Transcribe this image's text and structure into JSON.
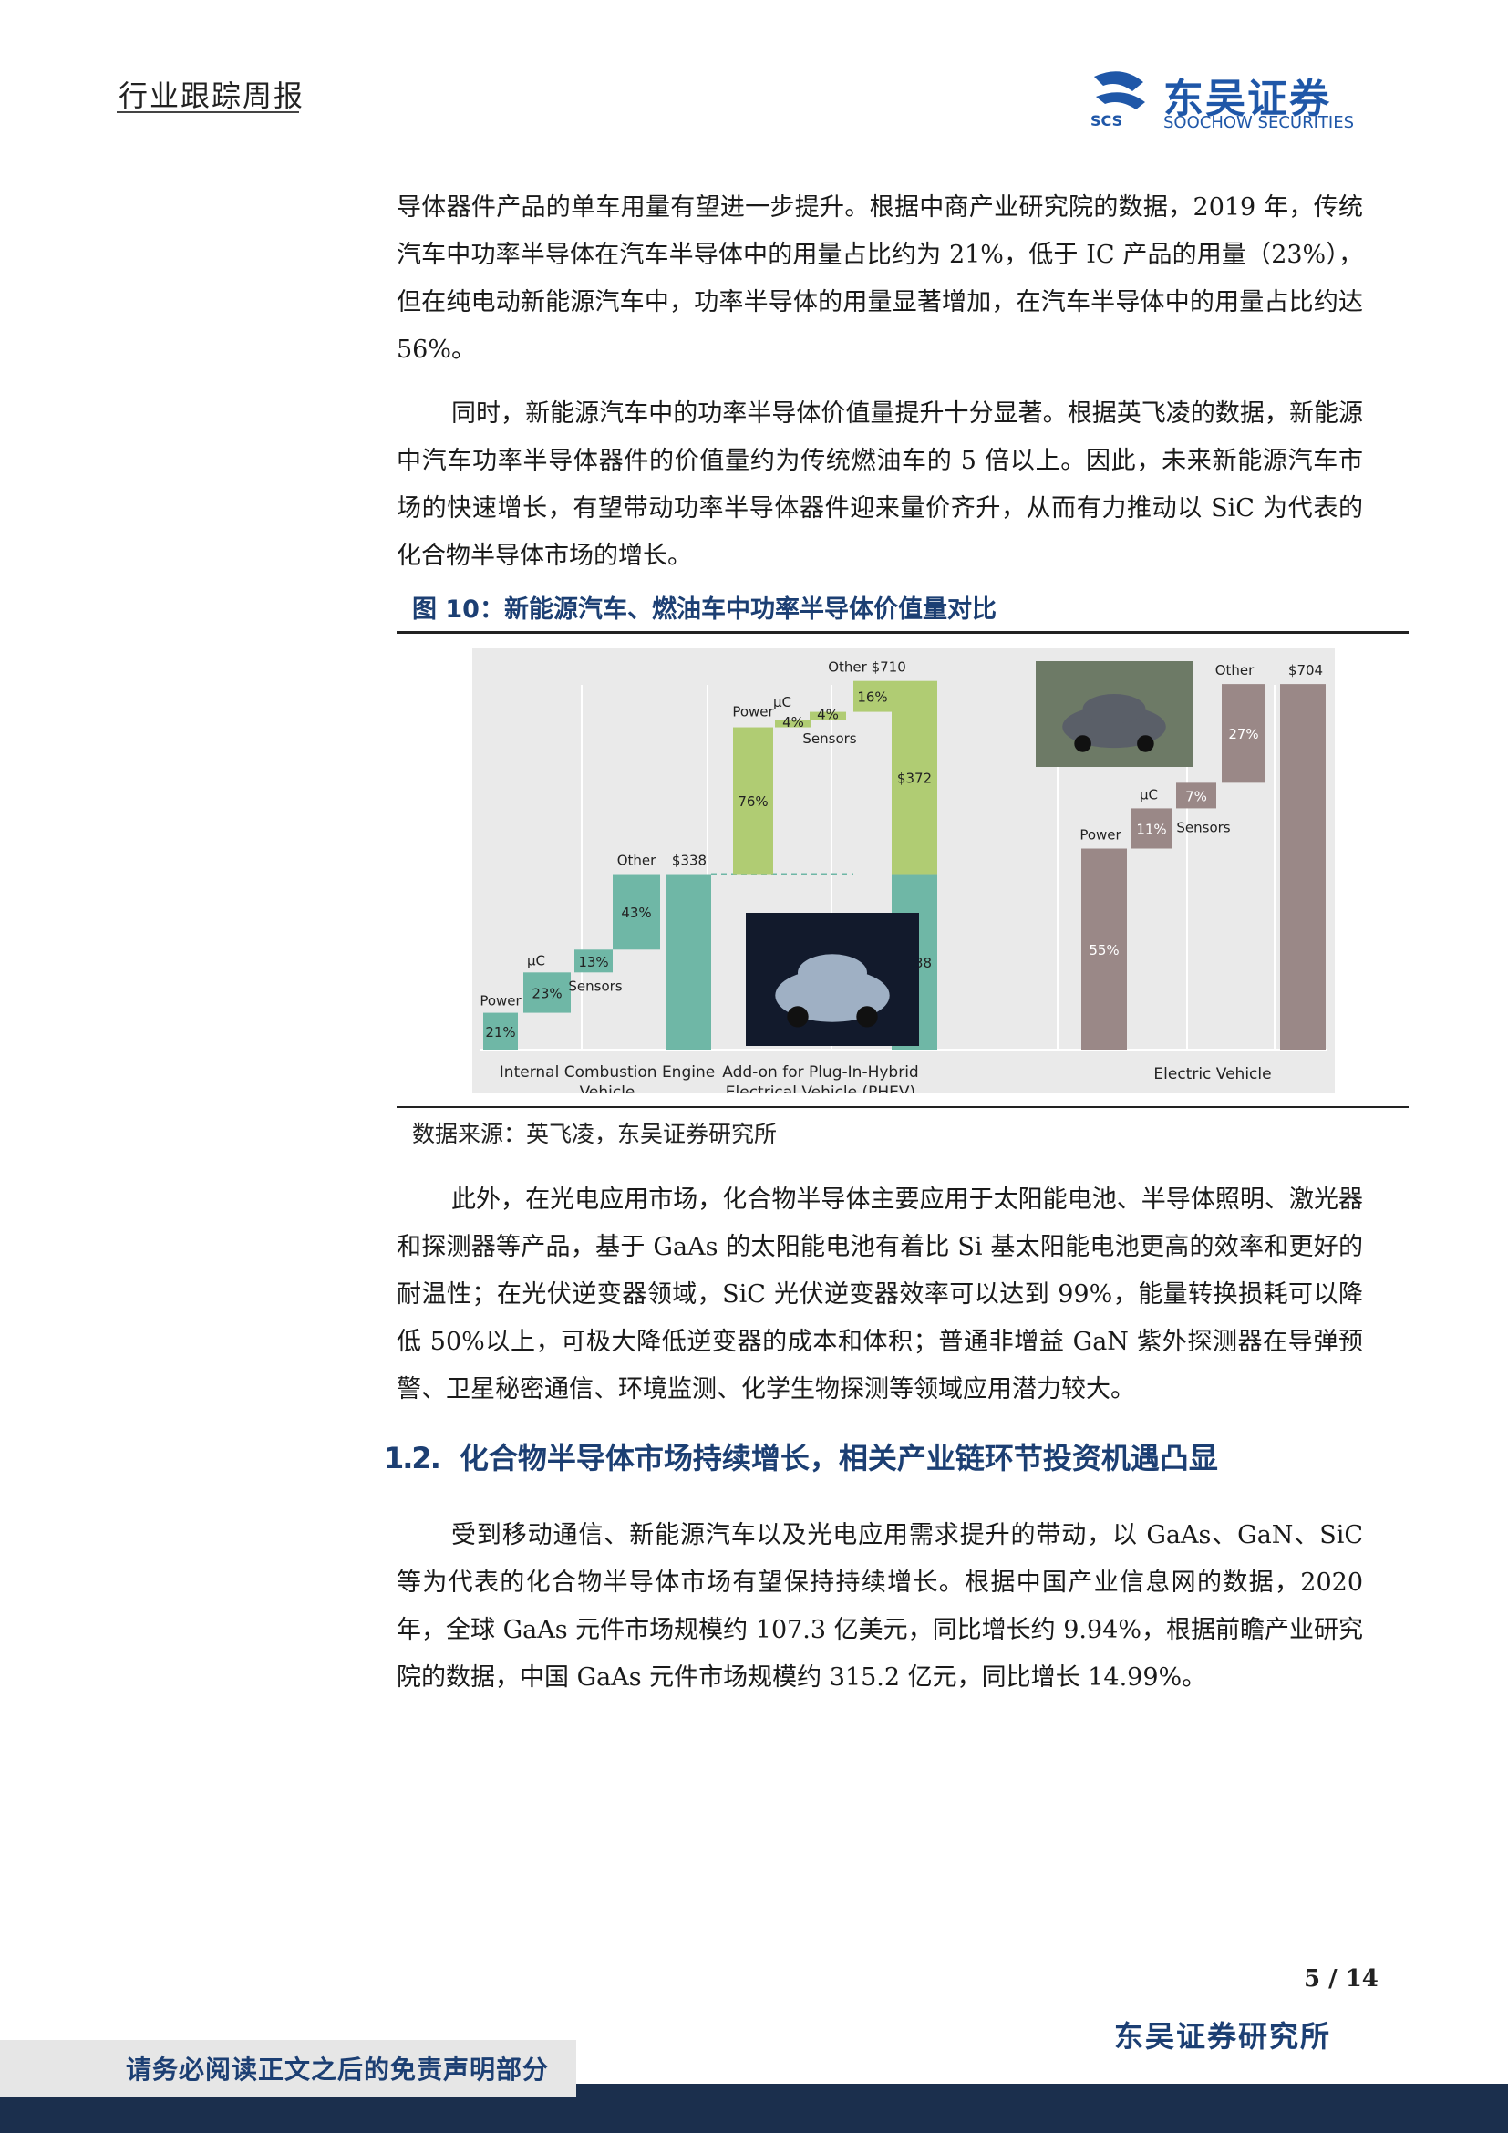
{
  "header": {
    "title": "行业跟踪周报",
    "logo_cn": "东吴证券",
    "logo_en": "SOOCHOW SECURITIES",
    "logo_mark_text": "SCS"
  },
  "paragraphs": {
    "p1": "导体器件产品的单车用量有望进一步提升。根据中商产业研究院的数据，2019 年，传统汽车中功率半导体在汽车半导体中的用量占比约为 21%，低于 IC 产品的用量（23%），但在纯电动新能源汽车中，功率半导体的用量显著增加，在汽车半导体中的用量占比约达 56%。",
    "p2": "同时，新能源汽车中的功率半导体价值量提升十分显著。根据英飞凌的数据，新能源中汽车功率半导体器件的价值量约为传统燃油车的 5 倍以上。因此，未来新能源汽车市场的快速增长，有望带动功率半导体器件迎来量价齐升，从而有力推动以 SiC 为代表的化合物半导体市场的增长。",
    "p3": "此外，在光电应用市场，化合物半导体主要应用于太阳能电池、半导体照明、激光器和探测器等产品，基于 GaAs 的太阳能电池有着比 Si 基太阳能电池更高的效率和更好的耐温性；在光伏逆变器领域，SiC 光伏逆变器效率可以达到 99%，能量转换损耗可以降低 50%以上，可极大降低逆变器的成本和体积；普通非增益 GaN 紫外探测器在导弹预警、卫星秘密通信、环境监测、化学生物探测等领域应用潜力较大。",
    "p4": "受到移动通信、新能源汽车以及光电应用需求提升的带动，以 GaAs、GaN、SiC 等为代表的化合物半导体市场有望保持持续增长。根据中国产业信息网的数据，2020 年，全球 GaAs 元件市场规模约 107.3 亿美元，同比增长约 9.94%，根据前瞻产业研究院的数据，中国 GaAs 元件市场规模约 315.2 亿元，同比增长 14.99%。"
  },
  "figure": {
    "title": "图 10：新能源汽车、燃油车中功率半导体价值量对比",
    "source": "数据来源：英飞凌，东吴证券研究所"
  },
  "section": {
    "number": "1.2.",
    "title": "化合物半导体市场持续增长，相关产业链环节投资机遇凸显"
  },
  "footer": {
    "page": "5 / 14",
    "org": "东吴证券研究所",
    "note": "请务必阅读正文之后的免责声明部分"
  },
  "colors": {
    "teal": "#6fb7a6",
    "green": "#b0cc73",
    "mauve": "#9a8887",
    "navy": "#1c3f73",
    "brand_blue": "#1f57a8"
  },
  "chart_data": {
    "type": "waterfall",
    "groups": [
      {
        "label_line1": "Internal Combustion Engine",
        "label_line2": "Vehicle",
        "components": [
          {
            "name": "Power",
            "pct": "21%"
          },
          {
            "name": "μC",
            "pct": "23%"
          },
          {
            "name": "Sensors",
            "pct": "13%"
          },
          {
            "name": "Other",
            "pct": "43%"
          }
        ],
        "total_label": "$338",
        "total": 338
      },
      {
        "label_line1": "Add-on for Plug-In-Hybrid",
        "label_line2": "Electrical Vehicle (PHEV)",
        "components": [
          {
            "name": "Power",
            "pct": "76%"
          },
          {
            "name": "μC",
            "pct": "4%"
          },
          {
            "name": "Sensors",
            "pct": "4%"
          },
          {
            "name": "Other",
            "pct": "16%"
          }
        ],
        "stack_base_label": "$338",
        "stack_add_label": "$372",
        "total_label": "$710",
        "total": 710
      },
      {
        "label_line1": "Electric Vehicle",
        "label_line2": "",
        "components": [
          {
            "name": "Power",
            "pct": "55%"
          },
          {
            "name": "μC",
            "pct": "11%"
          },
          {
            "name": "Sensors",
            "pct": "7%"
          },
          {
            "name": "Other",
            "pct": "27%"
          }
        ],
        "total_label": "$704",
        "total": 704
      }
    ]
  }
}
